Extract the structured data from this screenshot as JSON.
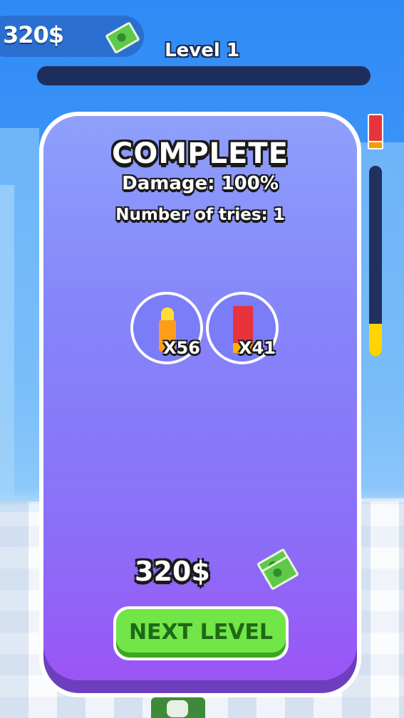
{
  "hud": {
    "money": "320$",
    "money_icon": "cash-icon",
    "level_title": "Level 1",
    "level_progress": 0
  },
  "ammo_gauge": {
    "icon": "shotgun-shell-icon",
    "fill_fraction": 0.17,
    "colors": {
      "track": "#22305e",
      "fill": "#ffd400"
    }
  },
  "result_card": {
    "title": "COMPLETE",
    "damage": "Damage: 100%",
    "tries": "Number of tries: 1",
    "ammo": [
      {
        "icon": "bullet-icon",
        "count": "X56"
      },
      {
        "icon": "shotgun-shell-icon",
        "count": "X41"
      }
    ],
    "reward": "320$",
    "reward_icon": "cash-icon",
    "next_button": "NEXT LEVEL"
  },
  "colors": {
    "card_top": "#8ea0fb",
    "card_bottom": "#9b55f5",
    "button": "#72e548",
    "button_text": "#1d6a15",
    "outline": "#1a1a1a"
  }
}
